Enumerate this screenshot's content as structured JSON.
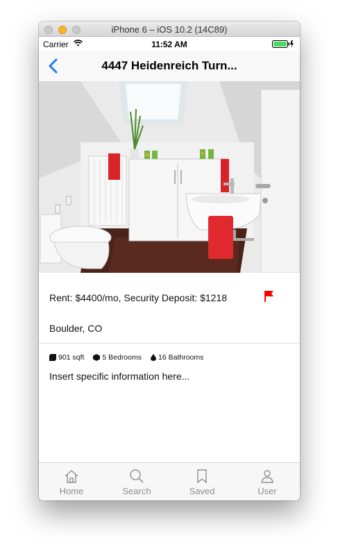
{
  "simulator": {
    "title": "iPhone 6 – iOS 10.2 (14C89)"
  },
  "status_bar": {
    "carrier": "Carrier",
    "time": "11:52 AM",
    "wifi_icon": "wifi-icon",
    "battery_icon": "battery-icon",
    "battery_level": 1.0,
    "battery_color": "#4cd964"
  },
  "nav": {
    "title": "4447 Heidenreich Turn...",
    "back_icon": "chevron-left-icon",
    "tint_color": "#1e7cf5"
  },
  "listing": {
    "rent_text": "Rent: $4400/mo, Security Deposit: $1218",
    "flag_icon": "flag-icon",
    "flag_color": "#ff0000",
    "location": "Boulder, CO",
    "features": [
      {
        "icon": "cube-icon",
        "text": "901 sqft"
      },
      {
        "icon": "box-icon",
        "text": "5 Bedrooms"
      },
      {
        "icon": "droplet-icon",
        "text": "16 Bathrooms"
      }
    ],
    "description": "Insert specific information here..."
  },
  "tabs": [
    {
      "icon": "home-icon",
      "label": "Home"
    },
    {
      "icon": "search-icon",
      "label": "Search"
    },
    {
      "icon": "bookmark-icon",
      "label": "Saved"
    },
    {
      "icon": "user-icon",
      "label": "User"
    }
  ]
}
